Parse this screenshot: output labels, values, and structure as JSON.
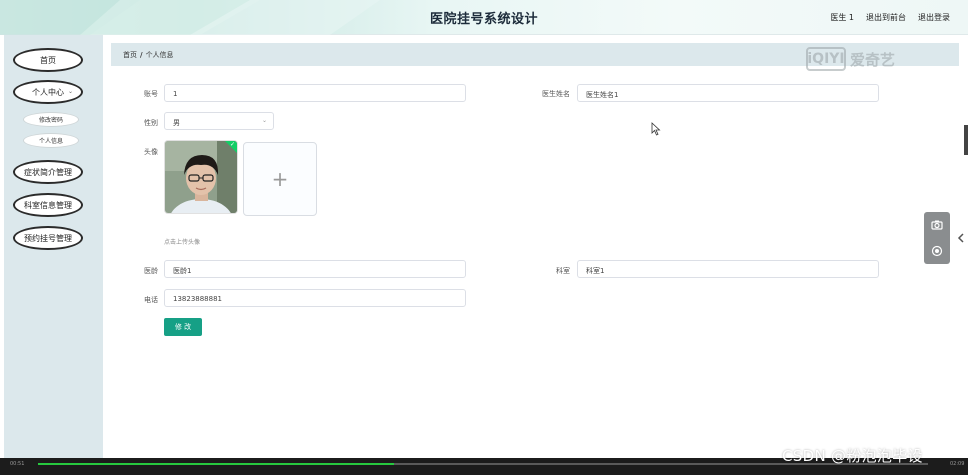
{
  "header": {
    "title": "医院挂号系统设计",
    "user": "医生 1",
    "back_to_front": "退出到前台",
    "logout": "退出登录"
  },
  "sidebar": {
    "items": [
      {
        "label": "首页"
      },
      {
        "label": "个人中心",
        "expanded": true
      },
      {
        "label": "症状简介管理"
      },
      {
        "label": "科室信息管理"
      },
      {
        "label": "预约挂号管理"
      }
    ],
    "sub_items": [
      {
        "label": "修改密码"
      },
      {
        "label": "个人信息"
      }
    ]
  },
  "breadcrumb": {
    "home": "首页",
    "separator": "/",
    "current": "个人信息"
  },
  "watermark": {
    "logo": "iQIYI",
    "text": "爱奇艺"
  },
  "form": {
    "account_label": "账号",
    "account_value": "1",
    "doctor_name_label": "医生姓名",
    "doctor_name_value": "医生姓名1",
    "gender_label": "性别",
    "gender_value": "男",
    "avatar_label": "头像",
    "upload_plus": "+",
    "upload_hint": "点击上传头像",
    "age_label": "医龄",
    "age_value": "医龄1",
    "department_label": "科室",
    "department_value": "科室1",
    "phone_label": "电话",
    "phone_value": "13823888881",
    "submit_label": "修 改"
  },
  "video_player": {
    "progress": 0.4,
    "time_left": "00:51",
    "time_right": "02:09",
    "progress_color": "#27c93f"
  },
  "credit": "CSDN @粉泡泡毕设",
  "colors": {
    "accent": "#16a086",
    "sidebar_bg": "#dce8ec",
    "breadcrumb_bg": "#dce8ec"
  },
  "icons": {
    "camera": "camera-icon",
    "target": "target-icon",
    "collapse": "chevron-left-icon",
    "select": "chevron-down-icon",
    "check": "check-icon"
  }
}
